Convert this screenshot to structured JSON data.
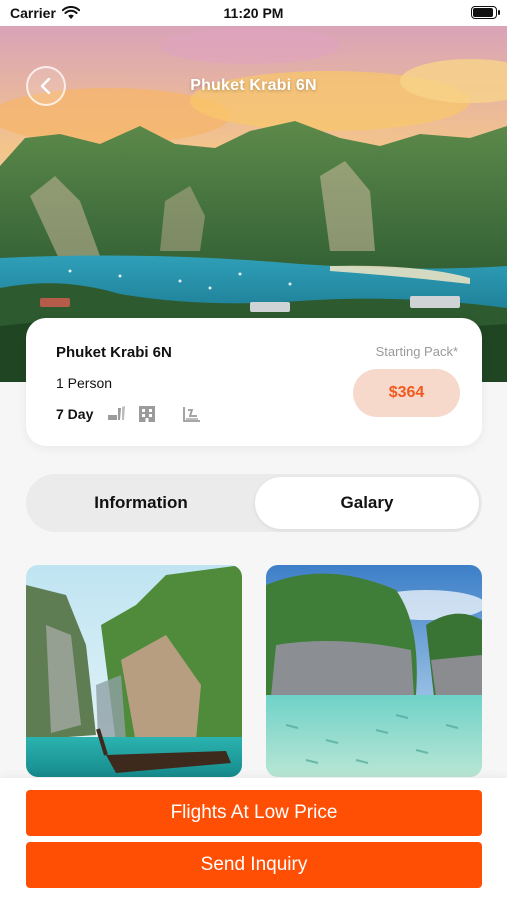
{
  "status": {
    "carrier": "Carrier",
    "time": "11:20 PM"
  },
  "header": {
    "title": "Phuket Krabi 6N"
  },
  "package": {
    "name": "Phuket Krabi 6N",
    "persons": "1 Person",
    "duration": "7 Day",
    "starting_label": "Starting Pack*",
    "price": "$364",
    "amenities": [
      "meal-icon",
      "hotel-icon",
      "transfer-icon"
    ]
  },
  "tabs": [
    {
      "label": "Information"
    },
    {
      "label": "Galary",
      "selected": true
    }
  ],
  "buttons": {
    "flights": "Flights At Low Price",
    "inquiry": "Send Inquiry"
  },
  "colors": {
    "accent": "#ff4f05",
    "price_bg": "#f7d9cc",
    "price_text": "#f05a1f"
  }
}
